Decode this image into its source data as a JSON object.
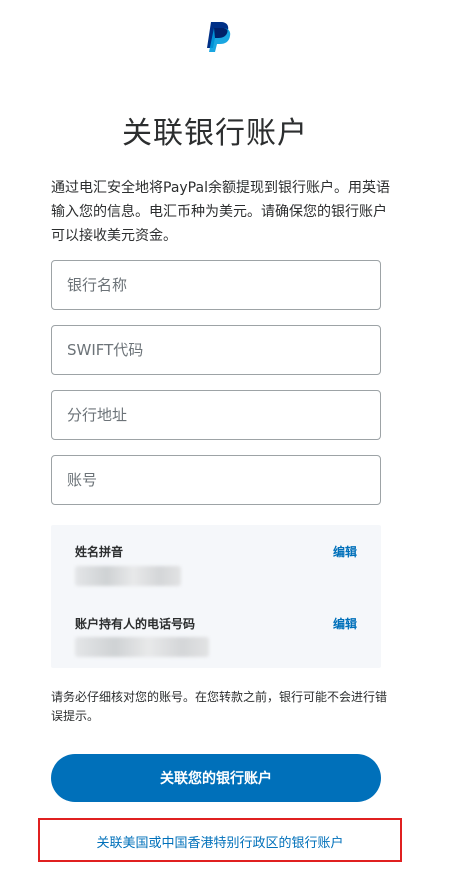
{
  "header": {
    "logo_icon": "paypal-logo-icon",
    "title": "关联银行账户"
  },
  "intro": {
    "text": "通过电汇安全地将PayPal余额提现到银行账户。用英语输入您的信息。电汇币种为美元。请确保您的银行账户可以接收美元资金。"
  },
  "form": {
    "bank_name_placeholder": "银行名称",
    "swift_placeholder": "SWIFT代码",
    "branch_address_placeholder": "分行地址",
    "account_number_placeholder": "账号"
  },
  "account_info": {
    "name_label": "姓名拼音",
    "name_edit": "编辑",
    "phone_label": "账户持有人的电话号码",
    "phone_edit": "编辑"
  },
  "notice": {
    "text": "请务必仔细核对您的账号。在您转款之前，银行可能不会进行错误提示。"
  },
  "actions": {
    "link_bank_button": "关联您的银行账户",
    "us_hk_link": "关联美国或中国香港特别行政区的银行账户"
  },
  "colors": {
    "brand_blue": "#0070ba",
    "paypal_dark": "#003087",
    "paypal_light": "#009cde",
    "highlight_red": "#e02020"
  }
}
